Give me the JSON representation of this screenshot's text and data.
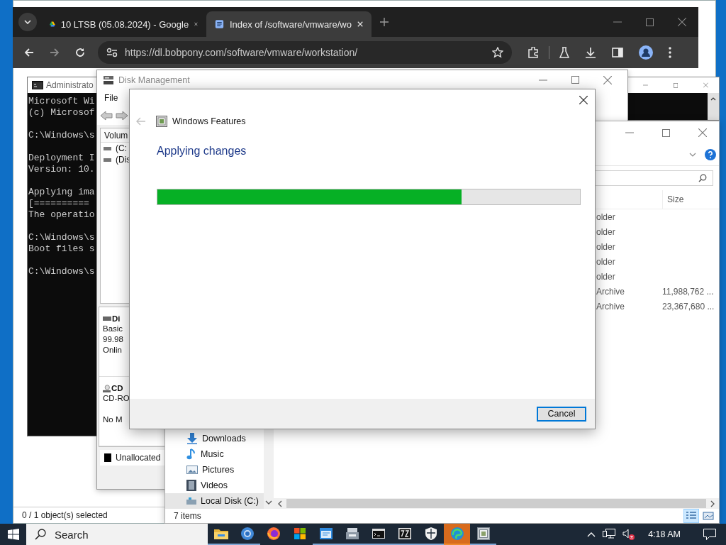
{
  "background_window": {
    "status": "0 / 1 object(s) selected"
  },
  "browser": {
    "tabs": [
      {
        "title": "10 LTSB (05.08.2024) - Google",
        "kind": "drive",
        "selected": false
      },
      {
        "title": "Index of /software/vmware/wo",
        "kind": "page",
        "selected": true
      }
    ],
    "address": "https://dl.bobpony.com/software/vmware/workstation/"
  },
  "command_prompt": {
    "title": "Administrato",
    "blocks": [
      [
        "Microsoft Wi",
        "(c) Microsof"
      ],
      [
        "C:\\Windows\\s"
      ],
      [
        "Deployment I",
        "Version: 10."
      ],
      [
        "Applying ima",
        "[==========",
        "The operatio"
      ],
      [
        "C:\\Windows\\s",
        "Boot files s"
      ],
      [
        "C:\\Windows\\s"
      ]
    ]
  },
  "disk_management": {
    "title": "Disk Management",
    "menu": [
      "File"
    ],
    "volume_header": "Volum",
    "volumes": [
      "(C:",
      "(Dis"
    ],
    "disks": [
      {
        "kind": "hdd",
        "name": "Di",
        "lines": [
          "Basic",
          "99.98",
          "Onlin"
        ]
      },
      {
        "kind": "cdrom",
        "name": "CD",
        "lines": [
          "CD-RO",
          "No M"
        ]
      }
    ],
    "legend": "Unallocated"
  },
  "explorer": {
    "size_header": "Size",
    "rows": [
      {
        "type": "older"
      },
      {
        "type": "older"
      },
      {
        "type": "older"
      },
      {
        "type": "older"
      },
      {
        "type": "older"
      },
      {
        "type": "Archive",
        "size": "11,988,762 ..."
      },
      {
        "type": "Archive",
        "size": "23,367,680 ..."
      }
    ],
    "nav_items": [
      {
        "kind": "downloads",
        "label": "Downloads",
        "selected": false
      },
      {
        "kind": "music",
        "label": "Music",
        "selected": false
      },
      {
        "kind": "pictures",
        "label": "Pictures",
        "selected": false
      },
      {
        "kind": "videos",
        "label": "Videos",
        "selected": false
      },
      {
        "kind": "drive",
        "label": "Local Disk (C:)",
        "selected": true
      }
    ],
    "status": "7 items",
    "views": [
      {
        "kind": "details",
        "selected": true
      },
      {
        "kind": "large-icons",
        "selected": false
      }
    ]
  },
  "dialog": {
    "title": "Windows Features",
    "heading": "Applying changes",
    "progress": {
      "level": 0.72
    },
    "buttons": [
      "Cancel"
    ]
  },
  "taskbar": {
    "search_placeholder": "Search",
    "apps": [
      {
        "kind": "folder",
        "running": true,
        "flashing": false
      },
      {
        "kind": "ring",
        "running": true,
        "flashing": false
      },
      {
        "kind": "flame",
        "running": false,
        "flashing": false
      },
      {
        "kind": "tiles",
        "running": false,
        "flashing": false
      },
      {
        "kind": "window",
        "running": true,
        "flashing": false
      },
      {
        "kind": "panel",
        "running": true,
        "flashing": false
      },
      {
        "kind": "terminal",
        "running": true,
        "flashing": false
      },
      {
        "kind": "archive",
        "running": true,
        "flashing": false
      },
      {
        "kind": "shield",
        "running": true,
        "flashing": false
      },
      {
        "kind": "swirl",
        "running": true,
        "flashing": true
      },
      {
        "kind": "features",
        "running": true,
        "flashing": false
      }
    ],
    "clock": "4:18 AM"
  }
}
